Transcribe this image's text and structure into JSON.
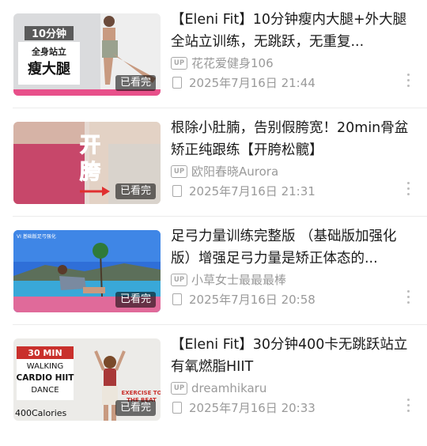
{
  "videos": [
    {
      "title": "【Eleni Fit】10分钟瘦内大腿+外大腿全站立训练，无跳跃，无重复...",
      "uploader": "花花爱健身106",
      "date": "2025年7月16日 21:44",
      "watched_label": "已看完",
      "thumb_text": [
        "10分钟",
        "全身站立",
        "瘦大腿"
      ]
    },
    {
      "title": "根除小肚腩，告别假胯宽！20min骨盆矫正纯跟练【开胯松髋】",
      "uploader": "欧阳春晓Aurora",
      "date": "2025年7月16日 21:31",
      "watched_label": "已看完",
      "thumb_text": [
        "开",
        "胯"
      ]
    },
    {
      "title": "足弓力量训练完整版 （基础版加强化版）增强足弓力量是矫正体态的...",
      "uploader": "小草女士最最最棒",
      "date": "2025年7月16日 20:58",
      "watched_label": "已看完",
      "thumb_text": [
        "VI 基础版足弓强化"
      ]
    },
    {
      "title": "【Eleni Fit】30分钟400卡无跳跃站立有氧燃脂HIIT",
      "uploader": "dreamhikaru",
      "date": "2025年7月16日 20:33",
      "watched_label": "已看完",
      "thumb_text": [
        "30 MIN",
        "WALKING",
        "CARDIO HIIT",
        "DANCE",
        "400Calories",
        "EXERCISE TO",
        "THE BEAT"
      ]
    }
  ],
  "icons": {
    "uploader": "up-badge-icon",
    "date": "calendar-icon",
    "more": "more-vertical-icon"
  },
  "badge_text": "UP",
  "colors": {
    "pink_accent": "#e8508a",
    "meta_gray": "#9a9a9a"
  }
}
